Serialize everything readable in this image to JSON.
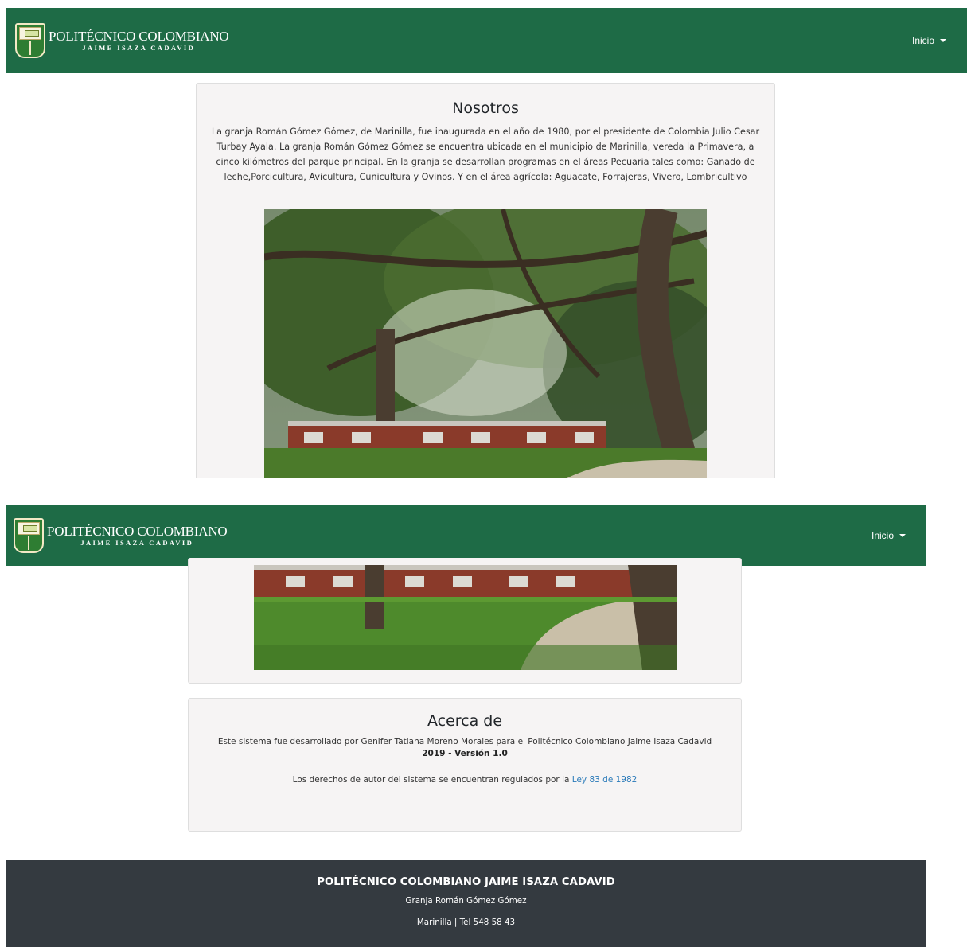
{
  "header": {
    "brand_title": "POLITÉCNICO COLOMBIANO",
    "brand_subtitle": "JAIME ISAZA CADAVID",
    "menu_label": "Inicio"
  },
  "nosotros": {
    "title": "Nosotros",
    "body": "La granja Román Gómez Gómez, de Marinilla, fue inaugurada en el año de 1980, por el presidente de Colombia Julio Cesar Turbay Ayala. La granja Román Gómez Gómez se encuentra ubicada en el municipio de Marinilla, vereda la Primavera, a cinco kilómetros del parque principal. En la granja se desarrollan programas en el áreas Pecuaria tales como: Ganado de leche,Porcicultura, Avicultura, Cunicultura y Ovinos. Y en el área agrícola: Aguacate, Forrajeras, Vivero, Lombricultivo"
  },
  "acerca": {
    "title": "Acerca de",
    "text": "Este sistema fue desarrollado por Genifer Tatiana Moreno Morales para el Politécnico Colombiano Jaime Isaza Cadavid",
    "version": "2019 - Versión 1.0",
    "legal_prefix": "Los derechos de autor del sistema se encuentran regulados por la ",
    "legal_link": "Ley 83 de 1982"
  },
  "footer": {
    "title": "POLITÉCNICO COLOMBIANO JAIME ISAZA CADAVID",
    "line1": "Granja Román Gómez Gómez",
    "line2": "Marinilla | Tel 548 58 43"
  },
  "colors": {
    "navbar": "#1e6b46",
    "footer": "#343a40",
    "card": "#f6f4f4",
    "link": "#2a7ab9"
  },
  "icons": {
    "logo": "institution-shield-icon",
    "menu_caret": "caret-down-icon"
  }
}
